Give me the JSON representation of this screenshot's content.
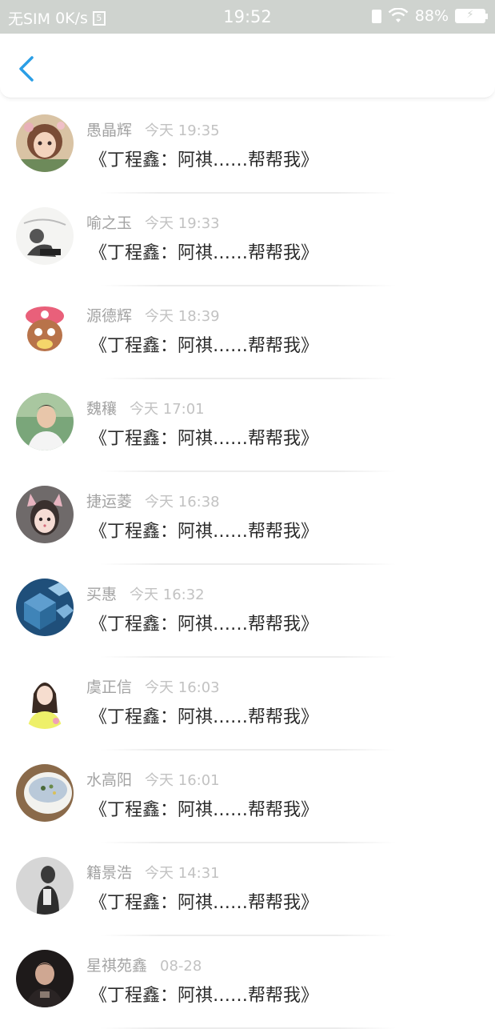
{
  "status_bar": {
    "carrier": "无SIM",
    "speed": "0K/s",
    "sim_icon": "5",
    "time": "19:52",
    "battery": "88%",
    "icons": [
      "sim-icon",
      "battery-saver-icon",
      "wifi-icon",
      "battery-icon"
    ]
  },
  "nav": {
    "back_icon": "chevron-left-icon",
    "accent": "#2a9ee6"
  },
  "conversations": [
    {
      "name": "愚晶辉",
      "time": "今天 19:35",
      "message": "《丁程鑫：阿祺……帮帮我》",
      "avatar_icon": "anime-girl-avatar"
    },
    {
      "name": "喻之玉",
      "time": "今天 19:33",
      "message": "《丁程鑫：阿祺……帮帮我》",
      "avatar_icon": "sketch-figure-avatar"
    },
    {
      "name": "源德辉",
      "time": "今天 18:39",
      "message": "《丁程鑫：阿祺……帮帮我》",
      "avatar_icon": "cartoon-reindeer-avatar"
    },
    {
      "name": "魏穰",
      "time": "今天 17:01",
      "message": "《丁程鑫：阿祺……帮帮我》",
      "avatar_icon": "young-man-avatar"
    },
    {
      "name": "捷运菱",
      "time": "今天 16:38",
      "message": "《丁程鑫：阿祺……帮帮我》",
      "avatar_icon": "cat-ear-girl-avatar"
    },
    {
      "name": "买惠",
      "time": "今天 16:32",
      "message": "《丁程鑫：阿祺……帮帮我》",
      "avatar_icon": "blue-cubes-avatar"
    },
    {
      "name": "虞正信",
      "time": "今天 16:03",
      "message": "《丁程鑫：阿祺……帮帮我》",
      "avatar_icon": "girl-yellow-shirt-avatar"
    },
    {
      "name": "水高阳",
      "time": "今天 16:01",
      "message": "《丁程鑫：阿祺……帮帮我》",
      "avatar_icon": "dessert-bowl-avatar"
    },
    {
      "name": "籍景浩",
      "time": "今天 14:31",
      "message": "《丁程鑫：阿祺……帮帮我》",
      "avatar_icon": "gray-figure-avatar"
    },
    {
      "name": "星祺苑鑫",
      "time": "08-28",
      "message": "《丁程鑫：阿祺……帮帮我》",
      "avatar_icon": "dark-portrait-avatar"
    }
  ]
}
